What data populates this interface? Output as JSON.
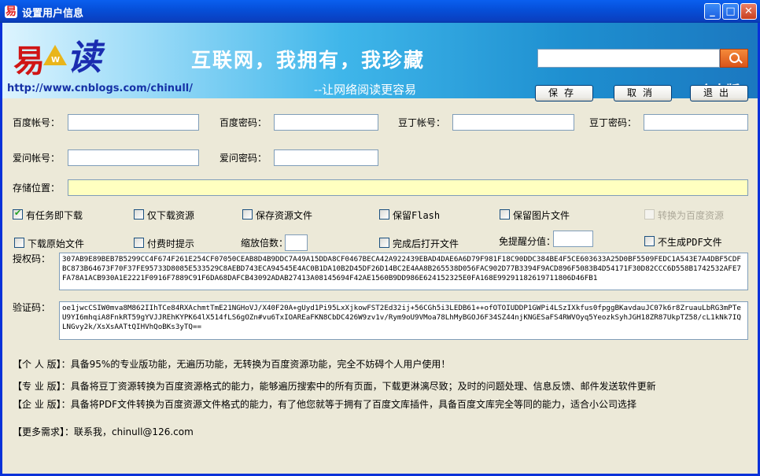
{
  "window": {
    "title": "设置用户信息",
    "app_icon": "易",
    "minimize_icon": "minimize-icon",
    "maximize_icon": "maximize-icon",
    "close_icon": "close-icon"
  },
  "banner": {
    "logo_char_1": "易",
    "logo_char_2": "读",
    "logo_w": "W",
    "url": "http://www.cnblogs.com/chinull/",
    "slogan": "互联网，我拥有，我珍藏",
    "sub_slogan": "--让网络阅读更容易",
    "edition": "个人版",
    "search_value": "",
    "search_icon": "search-icon"
  },
  "buttons": {
    "save": "保存",
    "cancel": "取消",
    "exit": "退出"
  },
  "fields": {
    "baidu_account_label": "百度帐号：",
    "baidu_password_label": "百度密码：",
    "douding_account_label": "豆丁帐号：",
    "douding_password_label": "豆丁密码：",
    "aiwen_account_label": "爱问帐号：",
    "aiwen_password_label": "爱问密码：",
    "storage_label": "存储位置：",
    "baidu_account": "",
    "baidu_password": "",
    "douding_account": "",
    "douding_password": "",
    "aiwen_account": "",
    "aiwen_password": "",
    "storage_path": ""
  },
  "options": {
    "download_now": {
      "label": "有任务即下载",
      "checked": true
    },
    "download_resource_only": {
      "label": "仅下载资源",
      "checked": false
    },
    "save_resource_file": {
      "label": "保存资源文件",
      "checked": false
    },
    "keep_flash": {
      "label": "保留Flash",
      "checked": false
    },
    "keep_image_file": {
      "label": "保留图片文件",
      "checked": false
    },
    "convert_baidu": {
      "label": "转换为百度资源",
      "checked": false,
      "disabled": true
    },
    "download_original": {
      "label": "下载原始文件",
      "checked": false
    },
    "paid_prompt": {
      "label": "付费时提示",
      "checked": false
    },
    "zoom_label": "缩放倍数：",
    "zoom_value": "",
    "open_after_done": {
      "label": "完成后打开文件",
      "checked": false
    },
    "remind_label": "免提醒分值：",
    "remind_value": "",
    "no_pdf": {
      "label": "不生成PDF文件",
      "checked": false
    }
  },
  "license": {
    "auth_label": "授权码：",
    "auth_code": "307AB9E89BEB7B5299CC4F674F261E254CF07050CEAB8D4B9DDC7A49A15DDA8CF0467BECA42A922439EBAD4DAE6A6D79F981F18C90DDC384BE4F5CE603633A25D0BF5509FEDC1A543E7A4DBF5CDFBC873B64673F70F37FE95733D8085E533529C8AEBD743ECA94545E4AC0B1DA10B2D45DF26D14BC2E4AA8B265538D056FAC902D77B3394F9ACD896F5083B4D54171F30D82CCC6D558B1742532AFE7FA78A1ACB930A1E2221F0916F7889C91F6DA68DAFCB43092ADAB27413A08145694F42AE1560B9DD986E624152325E0FA168E99291182619711806D46FB1",
    "verify_label": "验证码：",
    "verify_code": "oe1jwcCSIW0mva8M862IIhTCe84RXAchmtTmE21NGHoVJ/X40F20A+gUyd1Pi95LxXjkowFST2Ed32ij+56CGh5i3LEDB61++ofOTOIUDDP1GWPi4LSzIXkfus0fpggBKavdauJC07k6r8ZruauLbRG3mPTeU9YI6mhqiA8FnkRT59gYVJJREhKYPK64lX514fLS6gOZn#vu6TxIOAREaFKN8CbDC426W9zv1v/Rym9oU9VMoa78LhMyBGOJ6F34SZ44njKNGESaFS4RWVOyq5YeozkSyhJGH18ZR87UkpTZ58/cL1kNk7IQLNGvy2k/XsXsAATtQIHVhQoBKs3yTQ=="
  },
  "descriptions": {
    "personal": {
      "tag": "【个 人 版】：",
      "text": "具备95%的专业版功能，无遍历功能，无转换为百度资源功能，完全不妨碍个人用户使用！"
    },
    "professional": {
      "tag": "【专 业 版】：",
      "text": "具备将豆丁资源转换为百度资源格式的能力，能够遍历搜索中的所有页面，下载更淋漓尽致；及时的问题处理、信息反馈、邮件发送软件更新"
    },
    "enterprise": {
      "tag": "【企 业 版】：",
      "text": "具备将PDF文件转换为百度资源文件格式的能力，有了他您就等于拥有了百度文库插件，具备百度文库完全等同的能力，适合小公司选择"
    },
    "more": {
      "tag": "【更多需求】：",
      "text": "联系我，chinull@126.com"
    }
  }
}
